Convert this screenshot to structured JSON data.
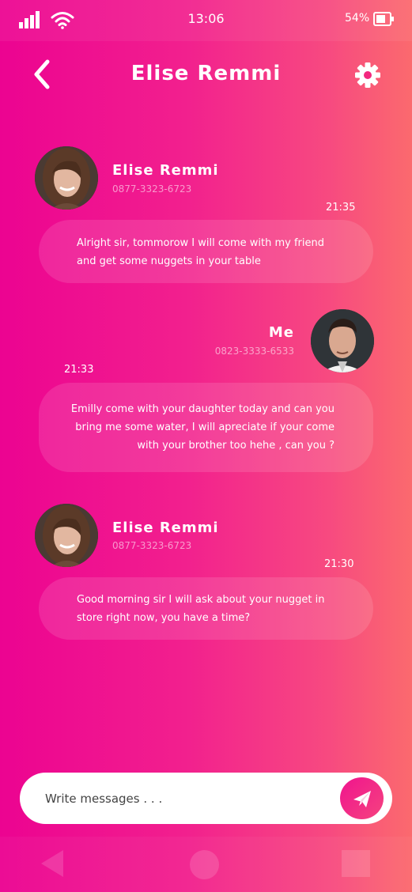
{
  "status_bar": {
    "time": "13:06",
    "battery_percent": "54%",
    "icons": [
      "signal-icon",
      "wifi-icon",
      "battery-icon"
    ]
  },
  "header": {
    "title": "Elise Remmi",
    "back_icon": "back-arrow-icon",
    "settings_icon": "gear-icon"
  },
  "messages": [
    {
      "sender": "Elise Remmi",
      "phone": "0877-3323-6723",
      "time": "21:35",
      "lines": [
        "Alright sir, tommorow I will come with my friend",
        "and get some nuggets in your table"
      ]
    },
    {
      "sender": "Me",
      "phone": "0823-3333-6533",
      "time": "21:33",
      "lines": [
        "Emilly come with your daughter today and can you",
        "bring me some water, I will apreciate if your come",
        "with your brother too hehe , can you ?"
      ]
    },
    {
      "sender": "Elise Remmi",
      "phone": "0877-3323-6723",
      "time": "21:30",
      "lines": [
        "Good morning sir I will ask about your nugget in",
        "store right now, you have a time?"
      ]
    }
  ],
  "composer": {
    "placeholder": "Write messages . . .",
    "value": "",
    "send_icon": "paper-plane-icon"
  },
  "colors": {
    "gradient_start": "#ec0391",
    "gradient_end": "#fb6a6e",
    "accent": "#f0148e"
  }
}
